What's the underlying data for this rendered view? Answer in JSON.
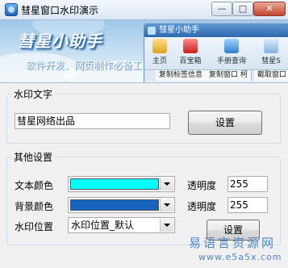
{
  "window": {
    "title": "彗星窗口水印演示",
    "controls": {
      "minimize": "—",
      "maximize": "□",
      "close": "✕"
    }
  },
  "banner": {
    "title": "彗星小助手",
    "subtitle": "软件开发、网页制作必备工具",
    "mini_app": {
      "title": "彗星小助手",
      "tools": [
        "主页",
        "百宝箱",
        "手册查询",
        "彗星S"
      ],
      "tabs": [
        "复制标签信息",
        "复制窗口 柯",
        "截取窗口"
      ]
    }
  },
  "watermark_group": {
    "label": "水印文字",
    "text_value": "彗星网络出品",
    "set_button": "设置"
  },
  "other_group": {
    "label": "其他设置",
    "text_color_label": "文本颜色",
    "text_color": "#00ffff",
    "bg_color_label": "背景颜色",
    "bg_color": "#1565c0",
    "opacity_label": "透明度",
    "text_opacity": "255",
    "bg_opacity": "255",
    "position_label": "水印位置",
    "position_value": "水印位置_默认",
    "set_button": "设置"
  },
  "site_watermark": {
    "name": "易语言资源网",
    "url": "www.e5a5x.com"
  },
  "colors": {
    "accent": "#2d69ae",
    "window_bg": "#f0f0f0"
  }
}
